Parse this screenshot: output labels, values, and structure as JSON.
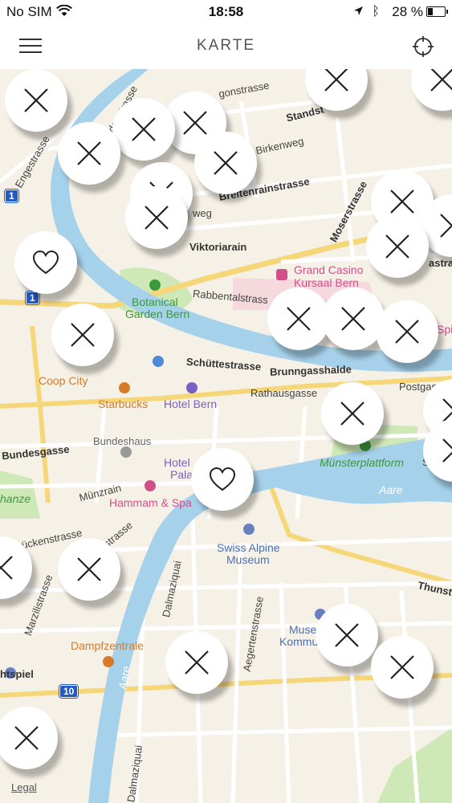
{
  "status": {
    "carrier": "No SIM",
    "time": "18:58",
    "battery": "28 %"
  },
  "header": {
    "title": "KARTE",
    "menu_icon": "hamburger-icon",
    "locate_icon": "crosshair-icon"
  },
  "map": {
    "legal": "Legal",
    "labels": {
      "engestrasse": "Engestrasse",
      "haldenstrasse": "haldenstrasse",
      "gonstrasse": "gonstrasse",
      "standstrasse": "Standst",
      "birkenweg": "Birkenweg",
      "breitenrain": "Breitenrainstrasse",
      "weg": "weg",
      "moserstrasse": "Moserstrasse",
      "viktoriarain": "Viktoriarain",
      "grand_casino": "Grand Casino",
      "kursaal": "Kursaal Bern",
      "astra": "astra",
      "botanical": "Botanical",
      "garden": "Garden Bern",
      "rabbental": "Rabbentalstrass",
      "spit": "Spit",
      "schuette": "Schüttestrasse",
      "brunngass": "Brunngasshalde",
      "coop": "Coop City",
      "starbucks": "Starbucks",
      "hotel_bern": "Hotel Bern",
      "rathausgasse": "Rathausgasse",
      "postgass": "Postgass",
      "bundeshaus": "Bundeshaus",
      "bundesgasse": "Bundesgasse",
      "hotel_palace": "Hotel",
      "palace2": "Pala",
      "muenster": "Münsterplattform",
      "sc": "Sc",
      "muenzrain": "Münzrain",
      "hammam": "Hammam & Spa",
      "aare1": "Aare",
      "schanze": "hanze",
      "ruecken": "rückenstrasse",
      "strasse": "strasse",
      "swiss1": "Swiss Alpine",
      "swiss2": "Museum",
      "thunstr": "Thunstr",
      "marzili": "Marzilistrasse",
      "dalmazi": "Dalmaziquai",
      "aegerten": "Aegertenstrasse",
      "dampf": "Dampfzentrale",
      "museum_k1": "Muse",
      "museum_k2": "Kommu",
      "aare2": "Aare",
      "htspiel": "htspiel",
      "dalmazi2": "Dalmaziquai"
    },
    "routes": [
      "1",
      "1",
      "10"
    ]
  },
  "pins": [
    {
      "type": "x",
      "name": "pin-1"
    },
    {
      "type": "x",
      "name": "pin-2"
    },
    {
      "type": "x",
      "name": "pin-3"
    },
    {
      "type": "x",
      "name": "pin-4"
    },
    {
      "type": "x",
      "name": "pin-5"
    },
    {
      "type": "x",
      "name": "pin-6"
    },
    {
      "type": "x",
      "name": "pin-7"
    },
    {
      "type": "x",
      "name": "pin-8"
    },
    {
      "type": "x",
      "name": "pin-9"
    },
    {
      "type": "x",
      "name": "pin-10"
    },
    {
      "type": "heart",
      "name": "pin-11"
    },
    {
      "type": "x",
      "name": "pin-12"
    },
    {
      "type": "x",
      "name": "pin-13"
    },
    {
      "type": "x",
      "name": "pin-14"
    },
    {
      "type": "x",
      "name": "pin-15"
    },
    {
      "type": "x",
      "name": "pin-16"
    },
    {
      "type": "x",
      "name": "pin-17"
    },
    {
      "type": "x",
      "name": "pin-18"
    },
    {
      "type": "heart",
      "name": "pin-19"
    },
    {
      "type": "x",
      "name": "pin-20"
    },
    {
      "type": "x",
      "name": "pin-21"
    },
    {
      "type": "x",
      "name": "pin-22"
    },
    {
      "type": "x",
      "name": "pin-23"
    },
    {
      "type": "x",
      "name": "pin-24"
    },
    {
      "type": "x",
      "name": "pin-25"
    },
    {
      "type": "x",
      "name": "pin-26"
    },
    {
      "type": "x",
      "name": "pin-27"
    }
  ]
}
